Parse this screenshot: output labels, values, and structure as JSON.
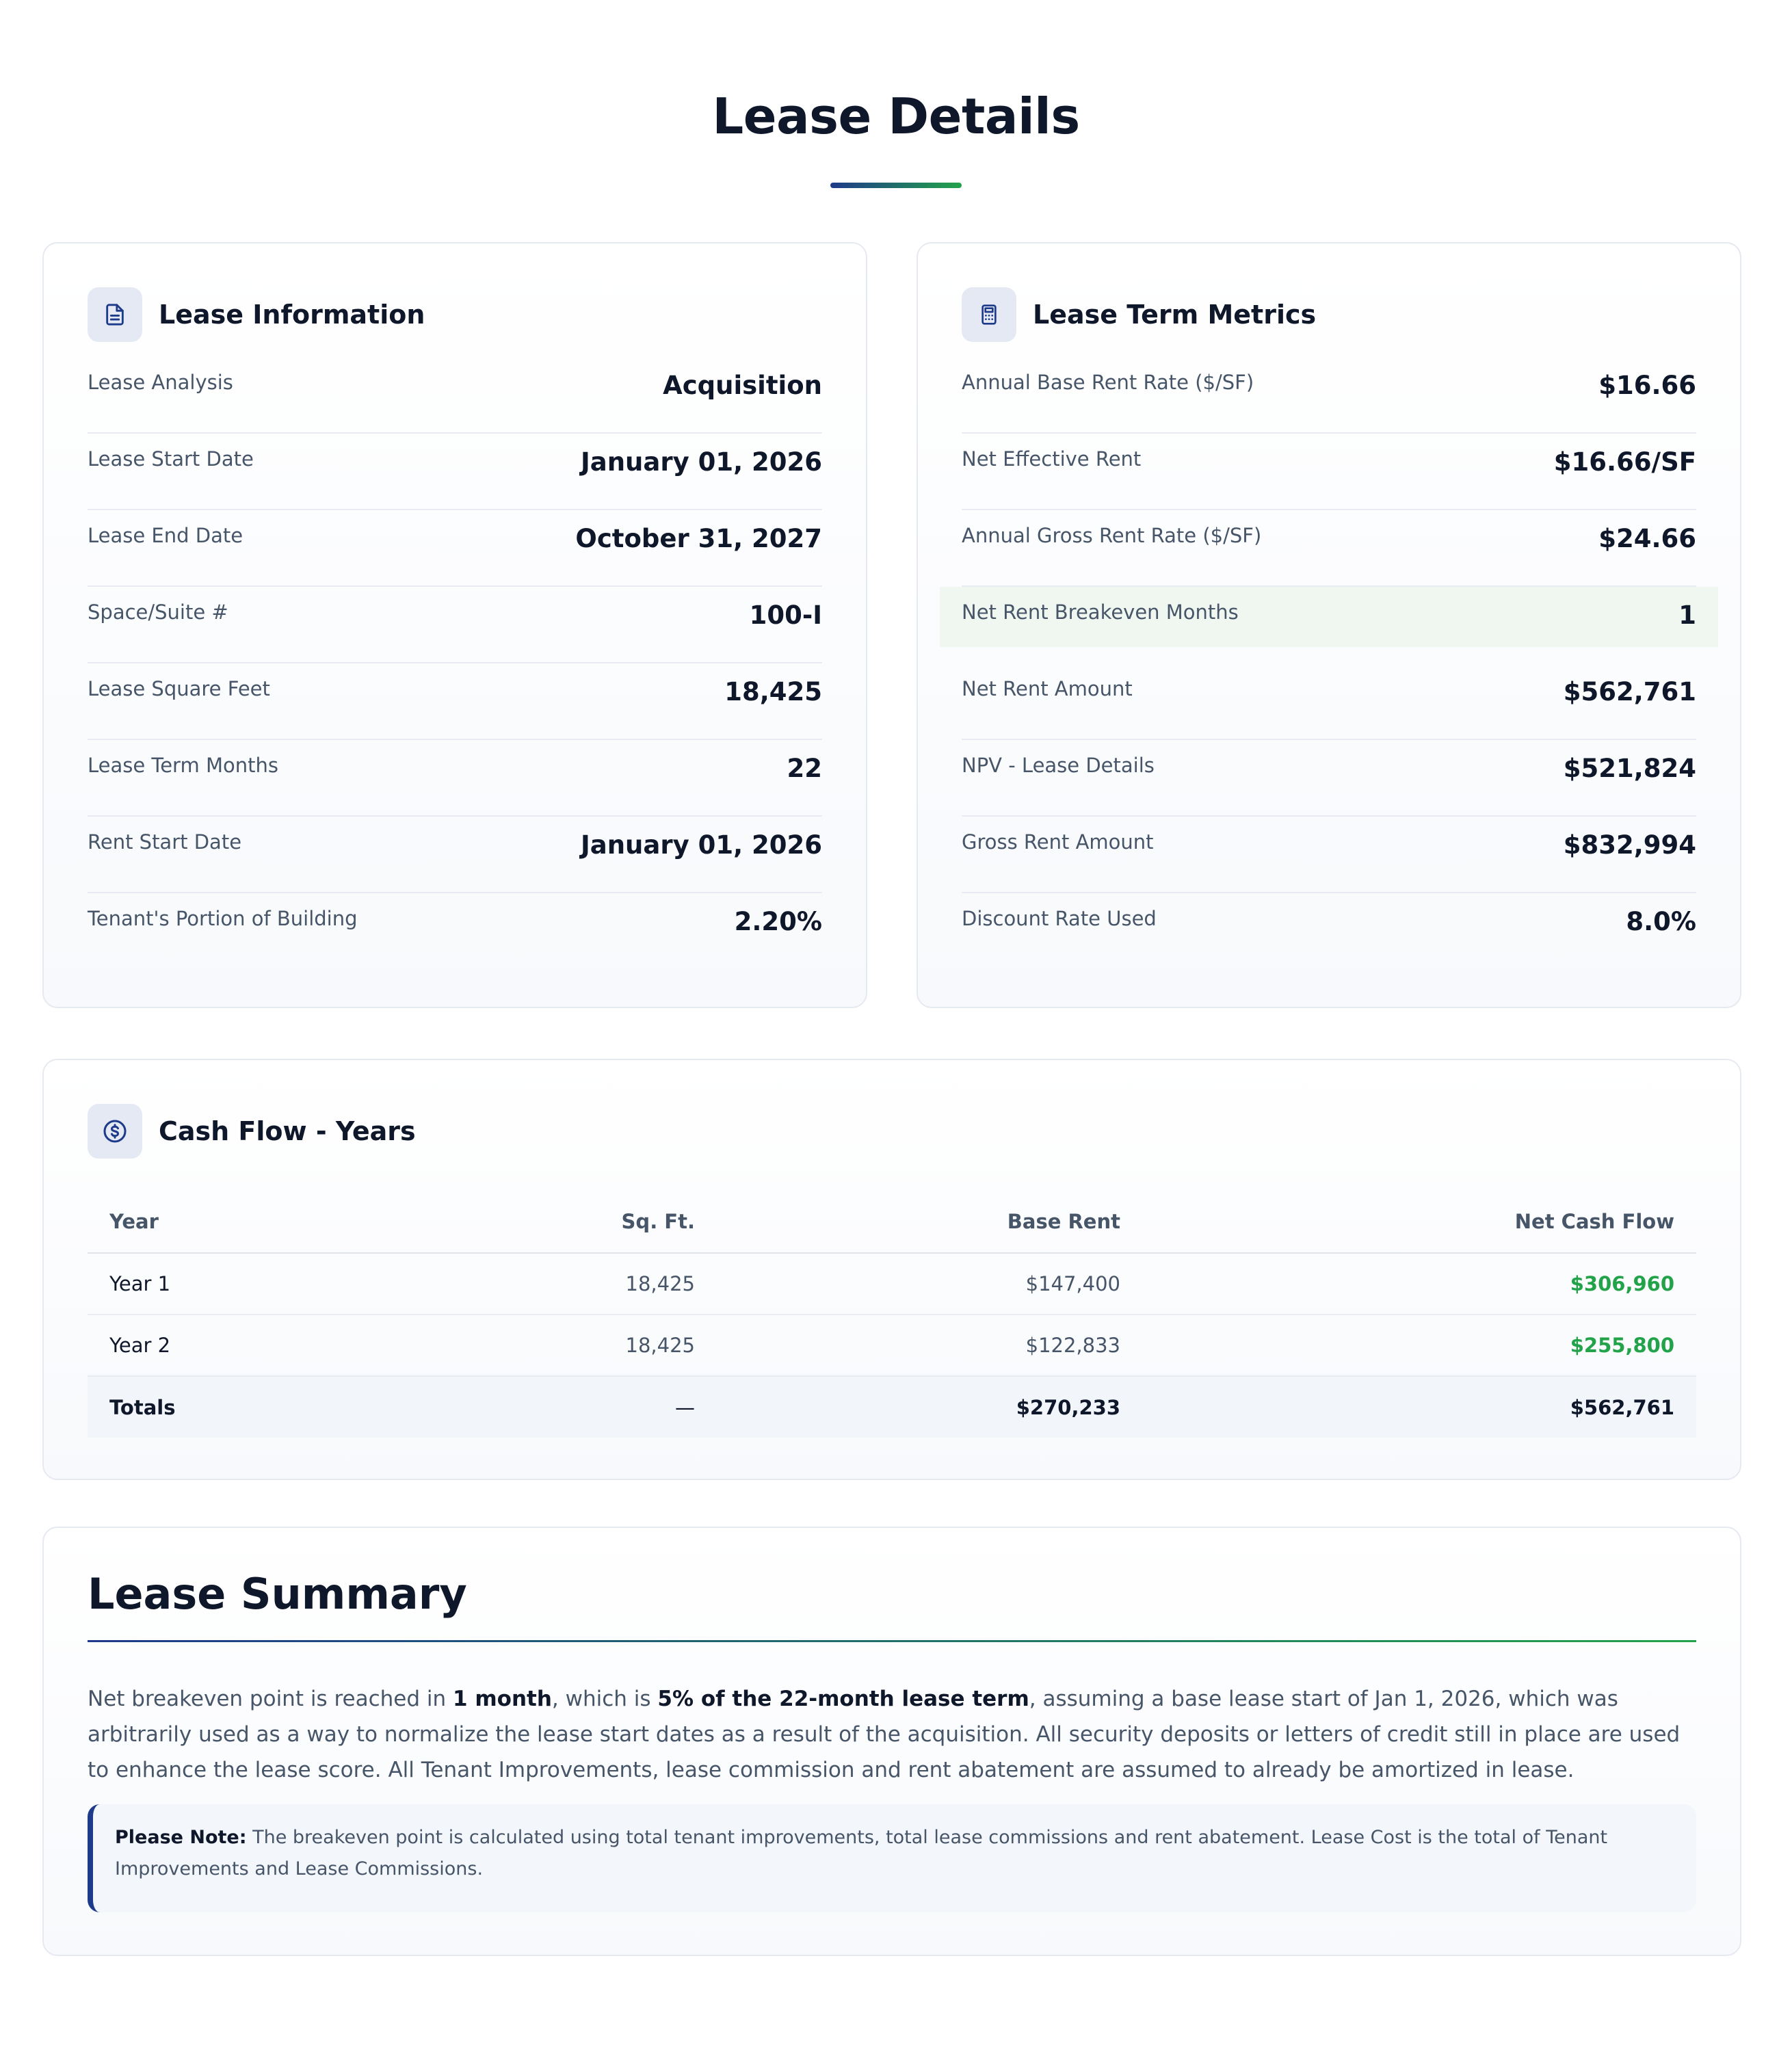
{
  "page": {
    "title": "Lease Details"
  },
  "lease_information": {
    "title": "Lease Information",
    "icon": "document-icon",
    "rows": [
      {
        "label": "Lease Analysis",
        "value": "Acquisition"
      },
      {
        "label": "Lease Start Date",
        "value": "January 01, 2026"
      },
      {
        "label": "Lease End Date",
        "value": "October 31, 2027"
      },
      {
        "label": "Space/Suite #",
        "value": "100-I"
      },
      {
        "label": "Lease Square Feet",
        "value": "18,425"
      },
      {
        "label": "Lease Term Months",
        "value": "22"
      },
      {
        "label": "Rent Start Date",
        "value": "January 01, 2026"
      },
      {
        "label": "Tenant's Portion of Building",
        "value": "2.20%"
      }
    ]
  },
  "lease_term_metrics": {
    "title": "Lease Term Metrics",
    "icon": "calculator-icon",
    "rows": [
      {
        "label": "Annual Base Rent Rate ($/SF)",
        "value": "$16.66"
      },
      {
        "label": "Net Effective Rent",
        "value": "$16.66/SF"
      },
      {
        "label": "Annual Gross Rent Rate ($/SF)",
        "value": "$24.66"
      },
      {
        "label": "Net Rent Breakeven Months",
        "value": "1"
      },
      {
        "label": "Net Rent Amount",
        "value": "$562,761"
      },
      {
        "label": "NPV - Lease Details",
        "value": "$521,824"
      },
      {
        "label": "Gross Rent Amount",
        "value": "$832,994"
      },
      {
        "label": "Discount Rate Used",
        "value": "8.0%"
      }
    ]
  },
  "cash_flow": {
    "title": "Cash Flow - Years",
    "icon": "dollar-circle-icon",
    "columns": [
      "Year",
      "Sq. Ft.",
      "Base Rent",
      "Net Cash Flow"
    ],
    "rows": [
      {
        "year": "Year 1",
        "sqft": "18,425",
        "base_rent": "$147,400",
        "net_cash_flow": "$306,960"
      },
      {
        "year": "Year 2",
        "sqft": "18,425",
        "base_rent": "$122,833",
        "net_cash_flow": "$255,800"
      }
    ],
    "totals": {
      "year": "Totals",
      "sqft": "—",
      "base_rent": "$270,233",
      "net_cash_flow": "$562,761"
    }
  },
  "summary": {
    "title": "Lease Summary",
    "text_1": "Net breakeven point is reached in ",
    "bold_1": "1 month",
    "text_2": ", which is ",
    "bold_2": "5% of the 22-month lease term",
    "text_3": ", assuming a base lease start of Jan 1, 2026, which was arbitrarily used as a way to normalize the lease start dates as a result of the acquisition. All security deposits or letters of credit still in place are used to enhance the lease score. All Tenant Improvements, lease commission and rent abatement are assumed to already be amortized in lease.",
    "note_label": "Please Note:",
    "note_text": " The breakeven point is calculated using total tenant improvements, total lease commissions and rent abatement. Lease Cost is the total of Tenant Improvements and Lease Commissions."
  },
  "colors": {
    "navy": "#1e3a8a",
    "green": "#22a34a",
    "text_dark": "#0f172a",
    "text_muted": "#475569",
    "highlight_row": "#f0f7f0"
  }
}
